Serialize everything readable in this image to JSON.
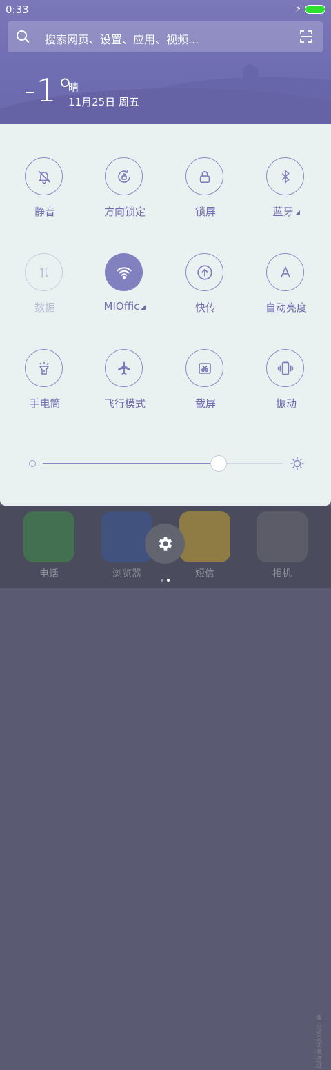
{
  "status": {
    "time": "0:33"
  },
  "search": {
    "placeholder": "搜索网页、设置、应用、视频..."
  },
  "weather": {
    "temp": "-1°",
    "condition": "晴",
    "date": "11月25日 周五"
  },
  "toggles": [
    {
      "label": "静音",
      "icon": "bell-off-icon",
      "state": "off"
    },
    {
      "label": "方向锁定",
      "icon": "rotation-lock-icon",
      "state": "off"
    },
    {
      "label": "锁屏",
      "icon": "lock-icon",
      "state": "off"
    },
    {
      "label": "蓝牙",
      "icon": "bluetooth-icon",
      "state": "off",
      "expandable": true
    },
    {
      "label": "数据",
      "icon": "data-arrows-icon",
      "state": "disabled"
    },
    {
      "label": "MIOffic",
      "icon": "wifi-icon",
      "state": "on",
      "expandable": true
    },
    {
      "label": "快传",
      "icon": "upload-icon",
      "state": "off"
    },
    {
      "label": "自动亮度",
      "icon": "auto-brightness-icon",
      "state": "off"
    },
    {
      "label": "手电筒",
      "icon": "flashlight-icon",
      "state": "off"
    },
    {
      "label": "飞行模式",
      "icon": "airplane-icon",
      "state": "off"
    },
    {
      "label": "截屏",
      "icon": "screenshot-icon",
      "state": "off"
    },
    {
      "label": "振动",
      "icon": "vibrate-icon",
      "state": "off"
    }
  ],
  "brightness": {
    "level": 0.73
  },
  "dock": {
    "apps": [
      {
        "label": "电话",
        "color": "#3f8f4a"
      },
      {
        "label": "浏览器",
        "color": "#3a5a9a"
      },
      {
        "label": "短信",
        "color": "#c9a531"
      },
      {
        "label": "相机",
        "color": "#6c6c72"
      }
    ]
  },
  "side_text": "双击这里切换壁纸",
  "colors": {
    "accent": "#8281c0",
    "panel": "#e9f2f1",
    "header": "#7a78b8"
  }
}
